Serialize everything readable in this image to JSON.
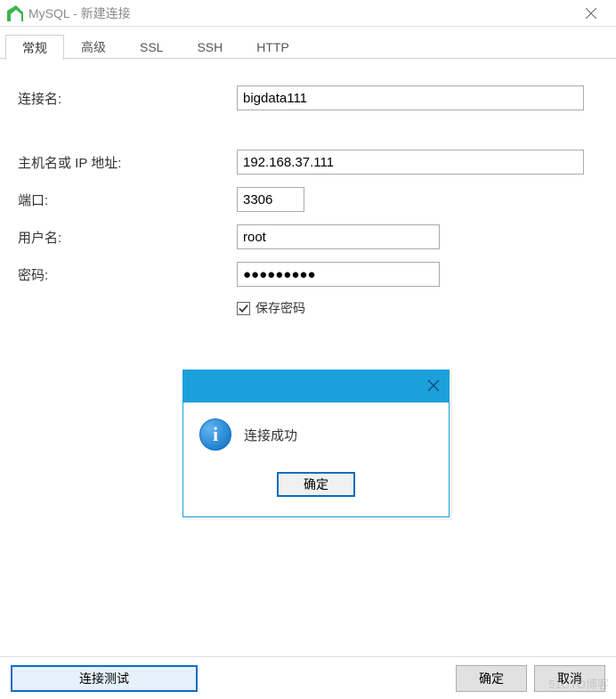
{
  "window": {
    "title": "MySQL - 新建连接"
  },
  "tabs": {
    "general": "常规",
    "advanced": "高级",
    "ssl": "SSL",
    "ssh": "SSH",
    "http": "HTTP"
  },
  "labels": {
    "connection_name": "连接名:",
    "host": "主机名或 IP 地址:",
    "port": "端口:",
    "username": "用户名:",
    "password": "密码:",
    "save_password": "保存密码"
  },
  "values": {
    "connection_name": "bigdata111",
    "host": "192.168.37.111",
    "port": "3306",
    "username": "root",
    "password": "●●●●●●●●●",
    "save_password_checked": true
  },
  "modal": {
    "message": "连接成功",
    "ok": "确定"
  },
  "buttons": {
    "test": "连接测试",
    "ok": "确定",
    "cancel": "取消"
  },
  "watermark": "51CTO博客"
}
